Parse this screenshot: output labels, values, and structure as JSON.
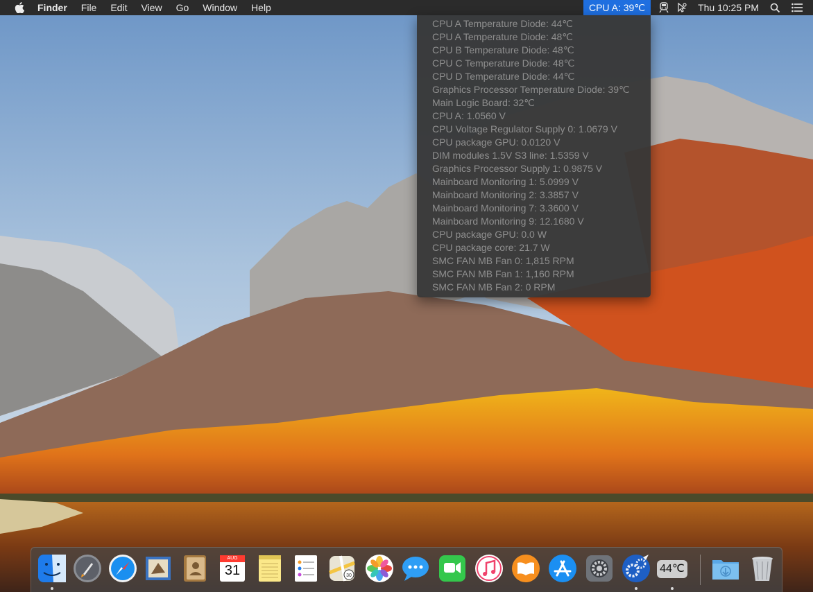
{
  "menubar": {
    "apple_icon": "apple-icon",
    "app_name": "Finder",
    "menus": [
      "File",
      "Edit",
      "View",
      "Go",
      "Window",
      "Help"
    ],
    "status_cpu": "CPU A: 39℃",
    "clock": "Thu 10:25 PM",
    "icons": [
      "train-icon",
      "cursor-icon",
      "search-icon",
      "list-icon"
    ]
  },
  "dropdown": {
    "rows": [
      "CPU A Temperature Diode: 44℃",
      "CPU A Temperature Diode: 48℃",
      "CPU B Temperature Diode: 48℃",
      "CPU C Temperature Diode: 48℃",
      "CPU D Temperature Diode: 44℃",
      "Graphics Processor Temperature Diode: 39℃",
      "Main Logic Board: 32℃",
      "CPU A: 1.0560 V",
      "CPU Voltage Regulator Supply 0: 1.0679 V",
      "CPU package GPU: 0.0120 V",
      "DIM modules 1.5V S3 line: 1.5359 V",
      "Graphics Processor Supply 1: 0.9875 V",
      "Mainboard Monitoring 1: 5.0999 V",
      "Mainboard Monitoring 2: 3.3857 V",
      "Mainboard Monitoring 7: 3.3600 V",
      "Mainboard Monitoring 9: 12.1680 V",
      "CPU package GPU: 0.0 W",
      "CPU package core: 21.7 W",
      "SMC FAN MB Fan 0: 1,815 RPM",
      "SMC FAN MB Fan 1: 1,160 RPM",
      "SMC FAN MB Fan 2: 0 RPM"
    ]
  },
  "dock": {
    "calendar_month": "AUG",
    "calendar_day": "31",
    "temp_badge": "44℃",
    "apps": [
      "Finder",
      "Launchpad",
      "Safari",
      "Mail",
      "Contacts",
      "Calendar",
      "Notes",
      "Reminders",
      "Maps",
      "Photos",
      "Messages",
      "FaceTime",
      "iTunes",
      "iBooks",
      "App Store",
      "System Preferences",
      "Hardware Monitor",
      "Temperature",
      "Downloads",
      "Trash"
    ]
  },
  "colors": {
    "menubar_bg": "#2b2b2b",
    "status_highlight": "#1f6fe0",
    "dropdown_bg": "#373737",
    "dropdown_text": "#8f8f8f"
  }
}
